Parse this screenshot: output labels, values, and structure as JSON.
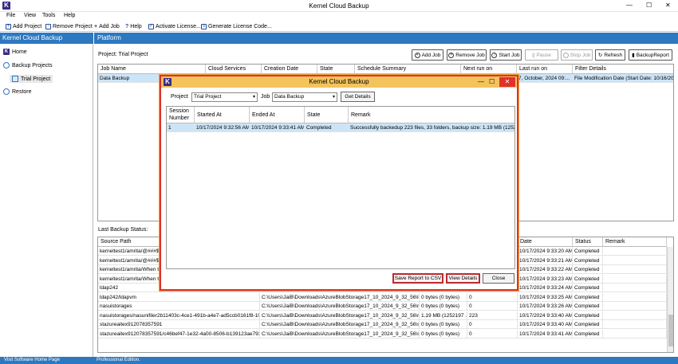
{
  "app": {
    "title": "Kernel Cloud Backup",
    "logo_letter": "K"
  },
  "window_controls": {
    "minimize": "—",
    "maximize": "☐",
    "close": "✕"
  },
  "menu": [
    "File",
    "View",
    "Tools",
    "Help"
  ],
  "toolbar": [
    {
      "label": "Add Project",
      "icon": "add-project-icon"
    },
    {
      "label": "Remove Project",
      "icon": "remove-project-icon"
    },
    {
      "label": "Add Job",
      "icon": "plus-icon"
    },
    {
      "label": "Help",
      "icon": "question-icon"
    },
    {
      "label": "Activate License...",
      "icon": "check-icon"
    },
    {
      "label": "Generate License Code...",
      "icon": "license-icon"
    }
  ],
  "sidebar": {
    "header": "Kernel Cloud Backup",
    "items": [
      {
        "label": "Home"
      },
      {
        "label": "Backup Projects"
      },
      {
        "label": "Trial Project"
      },
      {
        "label": "Restore"
      }
    ]
  },
  "platform": {
    "header": "Platform",
    "project_label": "Project: Trial Project",
    "buttons": [
      "Add Job",
      "Remove Job",
      "Start Job",
      "Pause",
      "Stop Job",
      "Refresh",
      "BackupReport"
    ],
    "jobs_table": {
      "columns": [
        "Job Name",
        "Cloud Services",
        "Creation Date",
        "State",
        "Schedule Summary",
        "Next run on",
        "Last run on",
        "Filter Details"
      ],
      "rows": [
        [
          "Data Backup",
          "",
          "",
          "",
          "",
          "",
          "7, October, 2024 09:...",
          "File Modification Date (Start Date: 10/16/202..."
        ]
      ]
    },
    "last_status_label": "Last Backup Status:",
    "status_table": {
      "columns": [
        "Source Path",
        "",
        "",
        "",
        "Date",
        "Status",
        "Remark"
      ],
      "rows": [
        [
          "kerneltest1/amrita/@###$$",
          "",
          "",
          "",
          "10/17/2024 9:33:20 AM",
          "Completed",
          ""
        ],
        [
          "kerneltest1/amrita/@###$$",
          "",
          "",
          "",
          "10/17/2024 9:33:21 AM",
          "Completed",
          ""
        ],
        [
          "kerneltest1/amrita/When th",
          "",
          "",
          "",
          "10/17/2024 9:33:22 AM",
          "Completed",
          ""
        ],
        [
          "kerneltest1/amrita/When th",
          "",
          "",
          "",
          "10/17/2024 9:33:23 AM",
          "Completed",
          ""
        ],
        [
          "ldap242",
          "",
          "",
          "",
          "10/17/2024 9:33:24 AM",
          "Completed",
          ""
        ],
        [
          "ldap242/ldapvm",
          "C:\\Users\\JaiB\\Downloads\\AzureBlobStorage17_10_2024_9_32_56\\lda...",
          "0 bytes (0 bytes)",
          "0",
          "10/17/2024 9:33:25 AM",
          "Completed",
          ""
        ],
        [
          "nasuistorages",
          "C:\\Users\\JaiB\\Downloads\\AzureBlobStorage17_10_2024_9_32_56\\nas...",
          "0 bytes (0 bytes)",
          "0",
          "10/17/2024 9:33:26 AM",
          "Completed",
          ""
        ],
        [
          "nasuistorages/nasunifiler2b11403c-4ce1-491b-a4e7-ad5ccb0161f8-10",
          "C:\\Users\\JaiB\\Downloads\\AzureBlobStorage17_10_2024_9_32_56\\nas...",
          "1.19 MB (1252197 ...",
          "223",
          "10/17/2024 9:33:40 AM",
          "Completed",
          ""
        ],
        [
          "stazureaitex912078357591",
          "C:\\Users\\JaiB\\Downloads\\AzureBlobStorage17_10_2024_9_32_56\\sta...",
          "0 bytes (0 bytes)",
          "0",
          "10/17/2024 9:33:40 AM",
          "Completed",
          ""
        ],
        [
          "stazureaitex912078357591/c46bef47-1e32-4a00-8506-b139123ae793-a...",
          "C:\\Users\\JaiB\\Downloads\\AzureBlobStorage17_10_2024_9_32_56\\sta...",
          "0 bytes (0 bytes)",
          "0",
          "10/17/2024 9:33:41 AM",
          "Completed",
          ""
        ]
      ]
    }
  },
  "dialog": {
    "title": "Kernel Cloud Backup",
    "project_label": "Project",
    "project_value": "Trial Project",
    "job_label": "Job",
    "job_value": "Data Backup",
    "get_details": "Get Details",
    "columns": [
      "Session Number",
      "Started At",
      "Ended At",
      "State",
      "Remark"
    ],
    "rows": [
      [
        "1",
        "10/17/2024 9:32:56 AM",
        "10/17/2024 9:33:41 AM",
        "Completed",
        "Successfully backedup 223 files, 33 folders, backup size: 1.19 MB (125219..."
      ]
    ],
    "save_csv": "Save Report to CSV",
    "view_details": "View Details",
    "close": "Close"
  },
  "statusbar": {
    "link": "Visit Software Home Page",
    "edition": "Professional Edition."
  },
  "colors": {
    "accent": "#2e78c0",
    "dialog_title": "#f3c35c",
    "highlight_border": "#c1272d",
    "selection": "#cce4f7"
  }
}
